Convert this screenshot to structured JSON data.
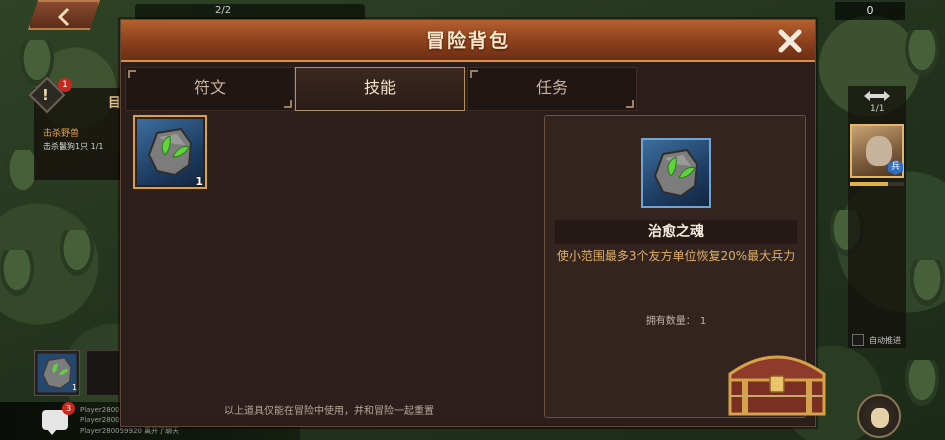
{
  "hud": {
    "progress_text": "2/2",
    "resource_count": "0",
    "quest": {
      "badge": "1",
      "heading": "目",
      "title": "击杀野兽",
      "description": "击杀鬣狗1只 1/1"
    },
    "slot_count": "1",
    "chat": {
      "badge": "3",
      "lines": [
        "Player2800",
        "Player2800",
        "Player280059920 离开了聊天"
      ]
    },
    "hero_count": "1/1",
    "hero_badge": "兵",
    "auto_battle_label": "自动推进",
    "hero_level_fraction": 0.7
  },
  "modal": {
    "title": "冒险背包",
    "close_icon": "close-icon",
    "tabs": [
      {
        "label": "符文",
        "active": false
      },
      {
        "label": "技能",
        "active": true
      },
      {
        "label": "任务",
        "active": false
      }
    ],
    "items": [
      {
        "icon": "healing-soul-icon",
        "count": "1",
        "selected": true
      }
    ],
    "hint": "以上道具仅能在冒险中使用，并和冒险一起重置",
    "detail": {
      "icon": "healing-soul-icon",
      "name": "治愈之魂",
      "description": "使小范围最多3个友方单位恢复20%最大兵力",
      "owned_label": "拥有数量：",
      "owned_value": "1"
    }
  },
  "colors": {
    "header_accent": "#b5612f",
    "gold_frame": "#d7a43f",
    "desc_text": "#e1b064",
    "item_blue": "#3d6e9e",
    "leaf_green": "#5fd23d"
  }
}
